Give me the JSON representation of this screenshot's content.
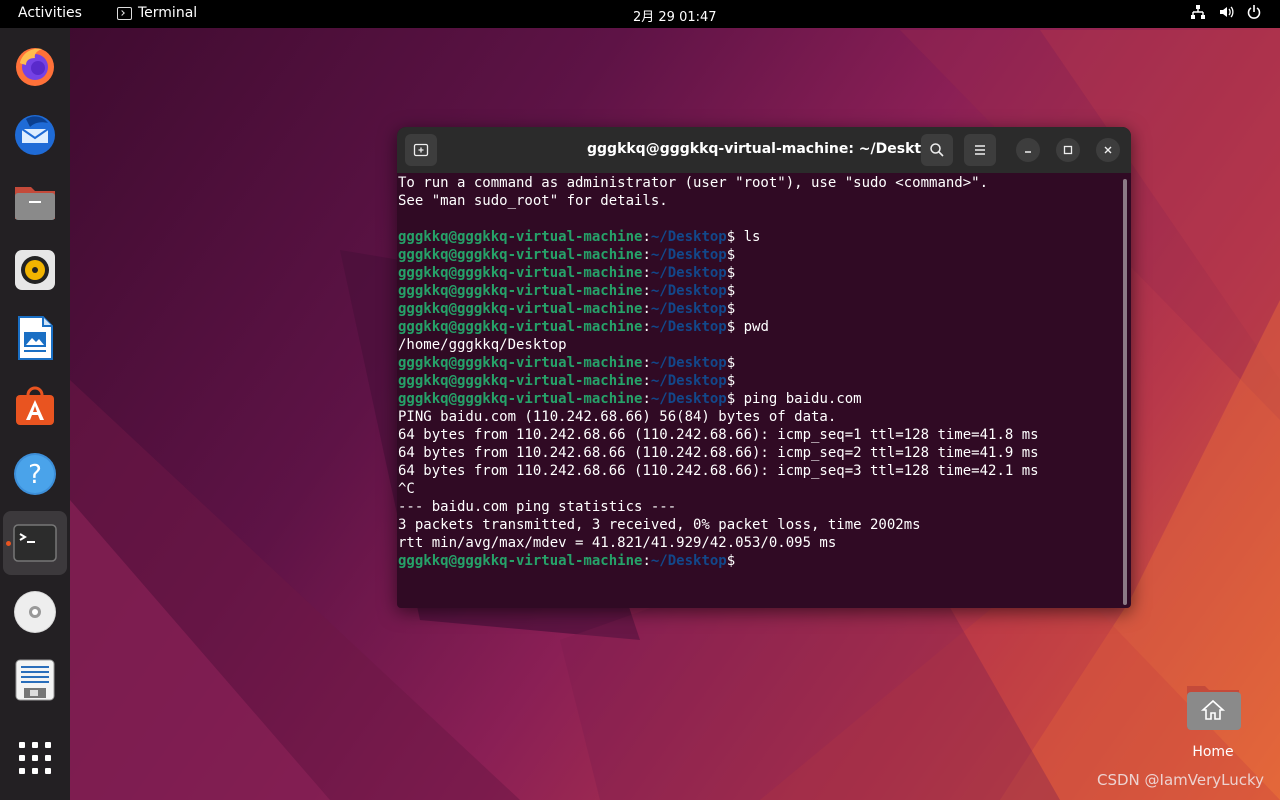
{
  "topbar": {
    "activities": "Activities",
    "app_name": "Terminal",
    "clock": "2月 29  01:47",
    "tray_icons": [
      "network-icon",
      "volume-icon",
      "power-icon"
    ]
  },
  "dock": {
    "apps": [
      "Firefox",
      "Thunderbird",
      "Files",
      "Rhythmbox",
      "LibreOffice Writer",
      "Ubuntu Software",
      "Help",
      "Terminal",
      "Disc",
      "Text Editor",
      "Show Applications"
    ]
  },
  "terminal": {
    "title": "gggkkq@gggkkq-virtual-machine: ~/Desktop",
    "user_host": "gggkkq@gggkkq-virtual-machine",
    "path": "~/Desktop",
    "lines": [
      {
        "t": "text",
        "text": "To run a command as administrator (user \"root\"), use \"sudo <command>\"."
      },
      {
        "t": "text",
        "text": "See \"man sudo_root\" for details."
      },
      {
        "t": "text",
        "text": ""
      },
      {
        "t": "prompt",
        "cmd": " ls"
      },
      {
        "t": "prompt",
        "cmd": ""
      },
      {
        "t": "prompt",
        "cmd": ""
      },
      {
        "t": "prompt",
        "cmd": ""
      },
      {
        "t": "prompt",
        "cmd": ""
      },
      {
        "t": "prompt",
        "cmd": " pwd"
      },
      {
        "t": "text",
        "text": "/home/gggkkq/Desktop"
      },
      {
        "t": "prompt",
        "cmd": ""
      },
      {
        "t": "prompt",
        "cmd": ""
      },
      {
        "t": "prompt",
        "cmd": " ping baidu.com"
      },
      {
        "t": "text",
        "text": "PING baidu.com (110.242.68.66) 56(84) bytes of data."
      },
      {
        "t": "text",
        "text": "64 bytes from 110.242.68.66 (110.242.68.66): icmp_seq=1 ttl=128 time=41.8 ms"
      },
      {
        "t": "text",
        "text": "64 bytes from 110.242.68.66 (110.242.68.66): icmp_seq=2 ttl=128 time=41.9 ms"
      },
      {
        "t": "text",
        "text": "64 bytes from 110.242.68.66 (110.242.68.66): icmp_seq=3 ttl=128 time=42.1 ms"
      },
      {
        "t": "text",
        "text": "^C"
      },
      {
        "t": "text",
        "text": "--- baidu.com ping statistics ---"
      },
      {
        "t": "text",
        "text": "3 packets transmitted, 3 received, 0% packet loss, time 2002ms"
      },
      {
        "t": "text",
        "text": "rtt min/avg/max/mdev = 41.821/41.929/42.053/0.095 ms"
      },
      {
        "t": "prompt",
        "cmd": ""
      }
    ]
  },
  "desktop": {
    "home_label": "Home",
    "watermark": "CSDN @IamVeryLucky"
  },
  "colors": {
    "accent": "#e95420",
    "terminal_bg": "#300a24",
    "prompt_user": "#26a269",
    "prompt_path": "#12488b"
  }
}
